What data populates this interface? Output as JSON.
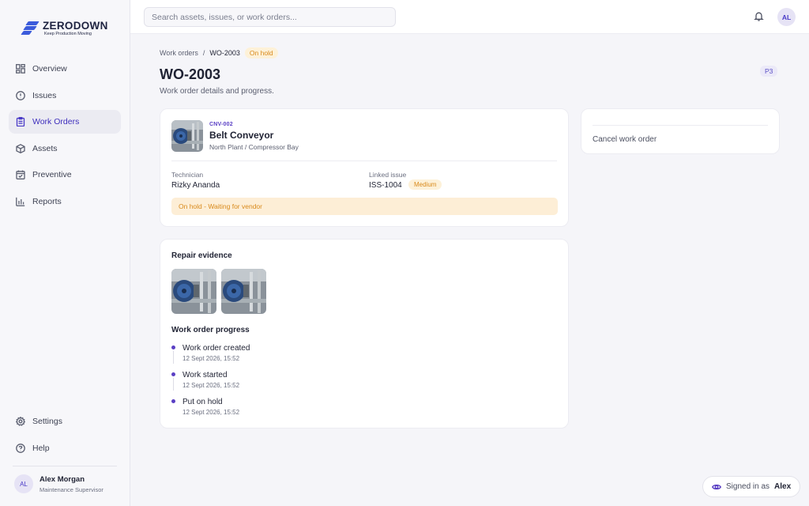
{
  "brand": {
    "name": "ZERODOWN",
    "tagline": "Keep Production Moving"
  },
  "nav": {
    "items": [
      {
        "label": "Overview",
        "icon": "grid-icon"
      },
      {
        "label": "Issues",
        "icon": "alert-circle-icon"
      },
      {
        "label": "Work Orders",
        "icon": "clipboard-icon",
        "active": true
      },
      {
        "label": "Assets",
        "icon": "cube-icon"
      },
      {
        "label": "Preventive",
        "icon": "calendar-check-icon"
      },
      {
        "label": "Reports",
        "icon": "bar-chart-icon"
      }
    ],
    "bottom": [
      {
        "label": "Settings",
        "icon": "gear-icon"
      },
      {
        "label": "Help",
        "icon": "help-circle-icon"
      }
    ]
  },
  "user": {
    "initials": "AL",
    "name": "Alex Morgan",
    "role": "Maintenance Supervisor"
  },
  "topbar": {
    "search_placeholder": "Search assets, issues, or work orders...",
    "avatar": "AL"
  },
  "breadcrumb": {
    "parent": "Work orders",
    "separator": "/",
    "current": "WO-2003",
    "status": "On hold"
  },
  "page": {
    "title": "WO-2003",
    "subtitle": "Work order details and progress.",
    "priority": "P3"
  },
  "asset": {
    "code": "CNV-002",
    "name": "Belt Conveyor",
    "location": "North Plant / Compressor Bay"
  },
  "details": {
    "technician_label": "Technician",
    "technician": "Rizky Ananda",
    "linked_issue_label": "Linked issue",
    "linked_issue": "ISS-1004",
    "issue_severity": "Medium",
    "hold_banner": "On hold - Waiting for vendor"
  },
  "actions": {
    "cancel": "Cancel work order"
  },
  "evidence": {
    "title": "Repair evidence"
  },
  "progress": {
    "title": "Work order progress",
    "steps": [
      {
        "label": "Work order created",
        "time": "12 Sept 2026, 15:52"
      },
      {
        "label": "Work started",
        "time": "12 Sept 2026, 15:52"
      },
      {
        "label": "Put on hold",
        "time": "12 Sept 2026, 15:52"
      }
    ]
  },
  "session": {
    "prefix": "Signed in as",
    "name": "Alex"
  },
  "colors": {
    "accent": "#4a3bc7",
    "hold": "#d98a1c",
    "hold_bg": "#fdeed6"
  }
}
